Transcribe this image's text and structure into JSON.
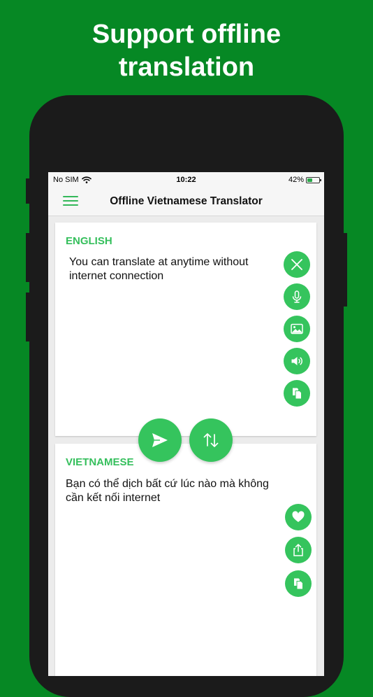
{
  "headline": {
    "line1": "Support offline",
    "line2": "translation"
  },
  "status_bar": {
    "carrier": "No SIM",
    "time": "10:22",
    "battery": "42%",
    "battery_level": 0.42
  },
  "nav": {
    "title": "Offline Vietnamese Translator",
    "menu_icon": "hamburger-menu-icon"
  },
  "source": {
    "language": "ENGLISH",
    "text": "You can translate at anytime without internet connection",
    "actions": [
      "clear-icon",
      "microphone-icon",
      "image-icon",
      "speaker-icon",
      "copy-icon"
    ]
  },
  "target": {
    "language": "VIETNAMESE",
    "text": "Bạn có thể dịch bất cứ lúc nào mà không cần kết nối internet",
    "actions": [
      "heart-icon",
      "share-icon",
      "copy-icon"
    ]
  },
  "controls": [
    "send-icon",
    "swap-icon"
  ],
  "colors": {
    "background": "#068824",
    "accent": "#35c45d",
    "label": "#35bf5c",
    "phone_frame": "#1b1b1b"
  }
}
